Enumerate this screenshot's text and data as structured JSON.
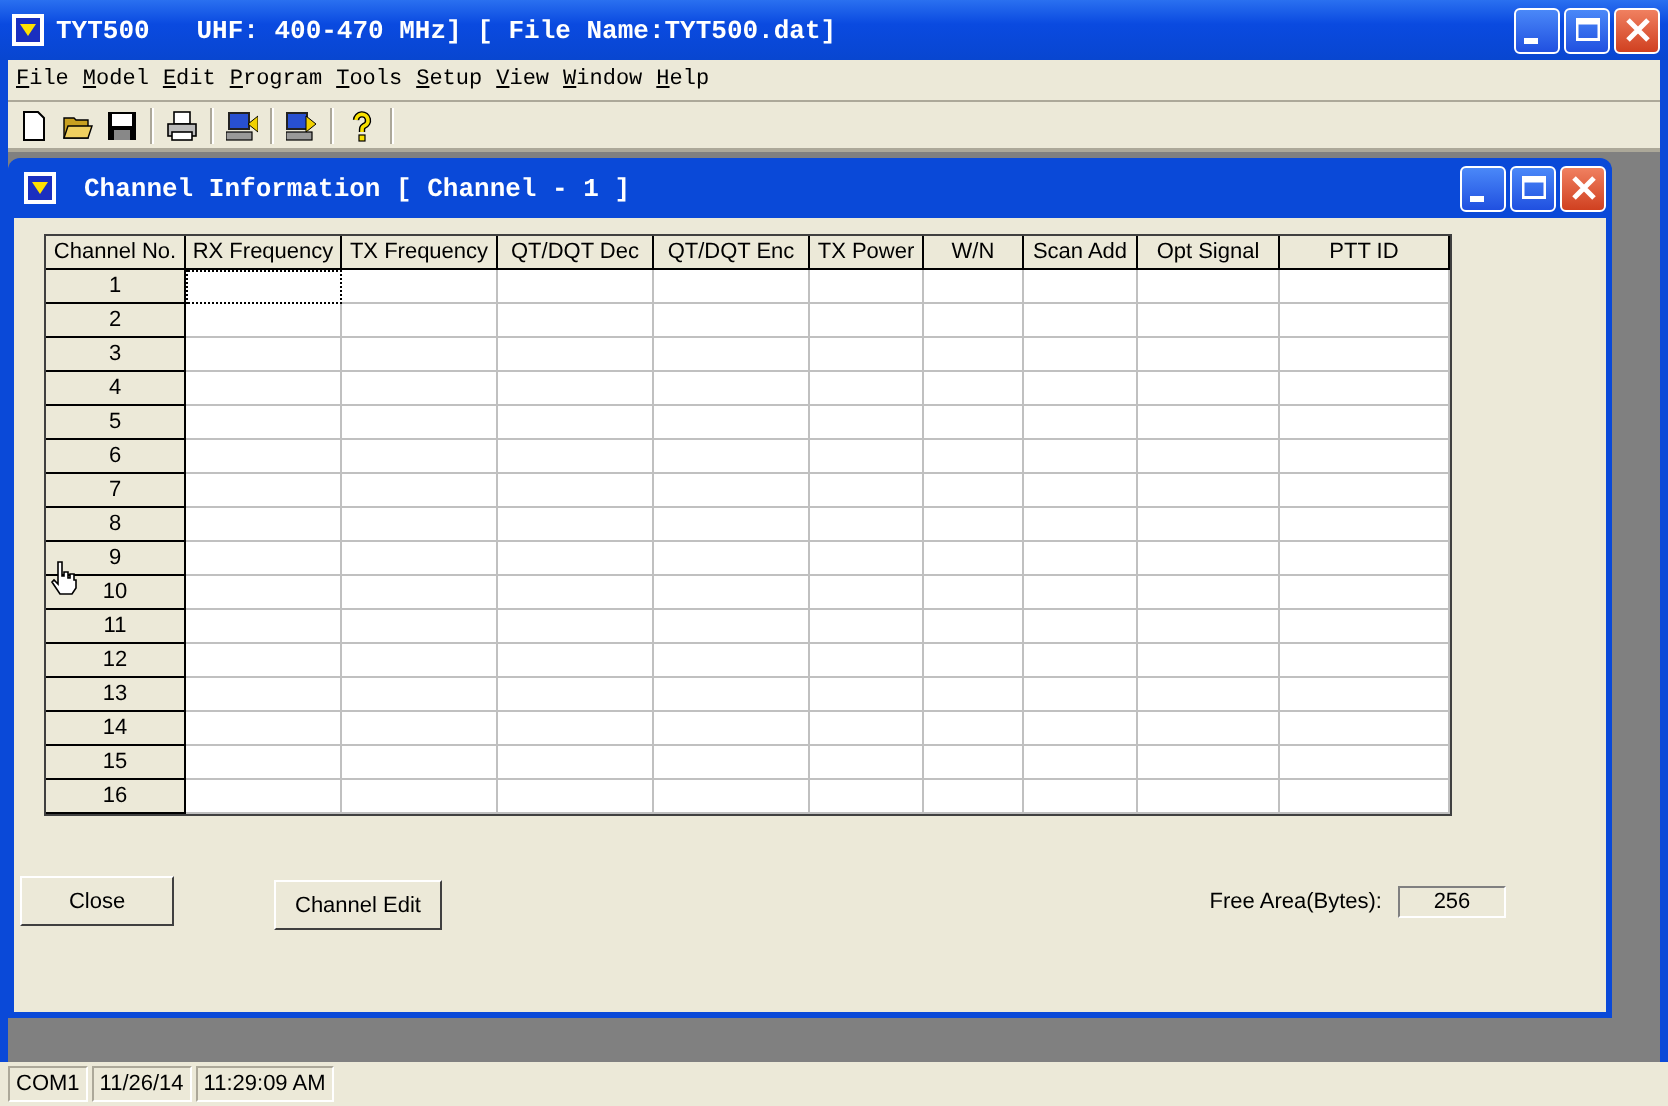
{
  "window": {
    "title": "TYT500   UHF: 400-470 MHz] [ File Name:TYT500.dat]"
  },
  "menu": [
    "File",
    "Model",
    "Edit",
    "Program",
    "Tools",
    "Setup",
    "View",
    "Window",
    "Help"
  ],
  "child_window": {
    "title": "Channel Information [ Channel - 1 ]"
  },
  "table": {
    "columns": [
      "Channel No.",
      "RX Frequency",
      "TX Frequency",
      "QT/DQT Dec",
      "QT/DQT Enc",
      "TX Power",
      "W/N",
      "Scan Add",
      "Opt Signal",
      "PTT ID"
    ],
    "rows": [
      {
        "number": "1",
        "focused": true
      },
      {
        "number": "2",
        "focused": false
      },
      {
        "number": "3",
        "focused": false
      },
      {
        "number": "4",
        "focused": false
      },
      {
        "number": "5",
        "focused": false
      },
      {
        "number": "6",
        "focused": false
      },
      {
        "number": "7",
        "focused": false
      },
      {
        "number": "8",
        "focused": false
      },
      {
        "number": "9",
        "focused": false
      },
      {
        "number": "10",
        "focused": false
      },
      {
        "number": "11",
        "focused": false
      },
      {
        "number": "12",
        "focused": false
      },
      {
        "number": "13",
        "focused": false
      },
      {
        "number": "14",
        "focused": false
      },
      {
        "number": "15",
        "focused": false
      },
      {
        "number": "16",
        "focused": false
      }
    ]
  },
  "buttons": [
    "Close",
    "Channel Edit"
  ],
  "free_area": {
    "label": "Free Area(Bytes):",
    "value": "256"
  },
  "status_bar": [
    "COM1",
    "11/26/14",
    "11:29:09 AM"
  ]
}
